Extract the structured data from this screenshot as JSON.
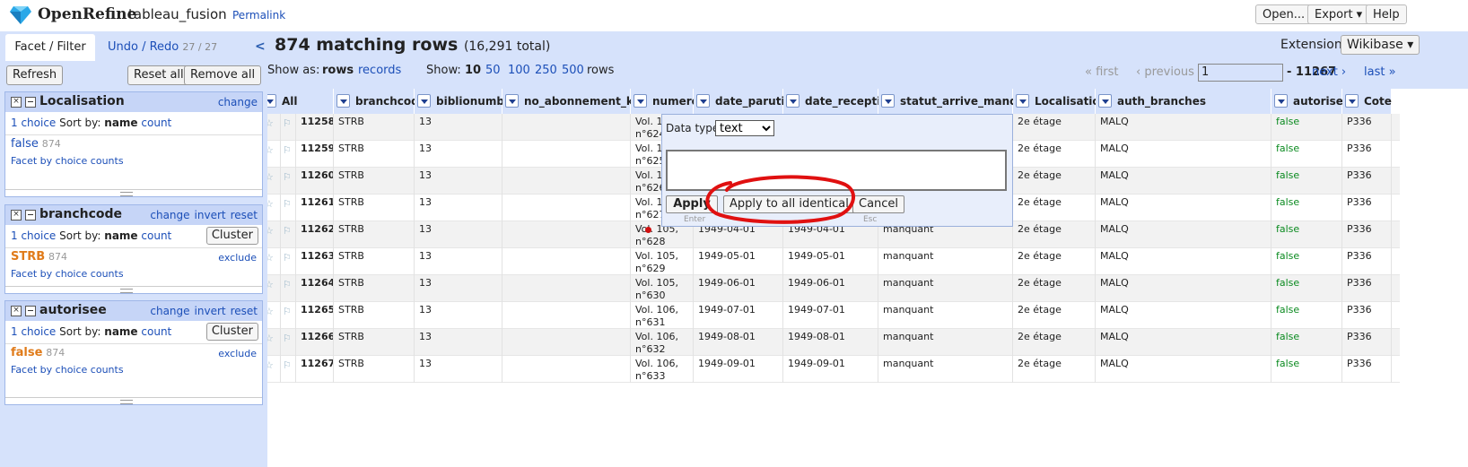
{
  "header": {
    "brand": "OpenRefine",
    "project_name": "tableau_fusion",
    "permalink": "Permalink",
    "buttons": {
      "open": "Open...",
      "export": "Export ▾",
      "help": "Help"
    }
  },
  "left_panel": {
    "tabs": {
      "facet_filter": "Facet / Filter",
      "undo_redo": "Undo / Redo",
      "undo_count": "27 / 27"
    },
    "refresh": "Refresh",
    "reset_all": "Reset all",
    "remove_all": "Remove all",
    "facets": [
      {
        "title": "Localisation",
        "links": [
          "change"
        ],
        "choices_text": "1 choice",
        "sort_by": "Sort by:",
        "sort_name": "name",
        "sort_count": "count",
        "cluster": "",
        "value": "false",
        "count": "874",
        "exclude": "",
        "footer": "Facet by choice counts",
        "value_color": "#1c4fb8"
      },
      {
        "title": "branchcode",
        "links": [
          "change",
          "invert",
          "reset"
        ],
        "choices_text": "1 choice",
        "sort_by": "Sort by:",
        "sort_name": "name",
        "sort_count": "count",
        "cluster": "Cluster",
        "value": "STRB",
        "count": "874",
        "exclude": "exclude",
        "footer": "Facet by choice counts",
        "value_color": "#e07b1a"
      },
      {
        "title": "autorisee",
        "links": [
          "change",
          "invert",
          "reset"
        ],
        "choices_text": "1 choice",
        "sort_by": "Sort by:",
        "sort_name": "name",
        "sort_count": "count",
        "cluster": "Cluster",
        "value": "false",
        "count": "874",
        "exclude": "exclude",
        "footer": "Facet by choice counts",
        "value_color": "#e07b1a"
      }
    ]
  },
  "toolbar": {
    "matching": "874 matching rows",
    "total": "(16,291 total)",
    "extensions": "Extensions",
    "wikibase": "Wikibase ▾",
    "show_as": "Show as:",
    "rows": "rows",
    "records": "records",
    "show": "Show:",
    "page_sizes": [
      "10",
      "50",
      "100",
      "250",
      "500"
    ],
    "rows_suffix": "rows",
    "first": "« first",
    "previous": "‹ previous",
    "page_input": "1",
    "page_total": "- 11267",
    "next": "next ›",
    "last": "last »"
  },
  "grid": {
    "all_label": "All",
    "columns": [
      "branchcode",
      "biblionumber",
      "no_abonnement_koha",
      "numero",
      "date_parution",
      "date_reception",
      "statut_arrive_manquant",
      "Localisation",
      "auth_branches",
      "autorisee",
      "Cote"
    ],
    "rows": [
      {
        "n": "11258.",
        "c": [
          "STRB",
          "13",
          "",
          "Vol. 1\nn°624",
          "",
          "",
          "",
          "2e étage",
          "MALQ",
          "false",
          "P336"
        ]
      },
      {
        "n": "11259.",
        "c": [
          "STRB",
          "13",
          "",
          "Vol. 1\nn°625",
          "",
          "",
          "",
          "2e étage",
          "MALQ",
          "false",
          "P336"
        ]
      },
      {
        "n": "11260.",
        "c": [
          "STRB",
          "13",
          "",
          "Vol. 1\nn°626",
          "",
          "",
          "",
          "2e étage",
          "MALQ",
          "false",
          "P336"
        ]
      },
      {
        "n": "11261.",
        "c": [
          "STRB",
          "13",
          "",
          "Vol. 1\nn°627",
          "",
          "",
          "",
          "2e étage",
          "MALQ",
          "false",
          "P336"
        ]
      },
      {
        "n": "11262.",
        "c": [
          "STRB",
          "13",
          "",
          "Vol. 105,\nn°628",
          "1949-04-01",
          "1949-04-01",
          "manquant",
          "2e étage",
          "MALQ",
          "false",
          "P336"
        ]
      },
      {
        "n": "11263.",
        "c": [
          "STRB",
          "13",
          "",
          "Vol. 105,\nn°629",
          "1949-05-01",
          "1949-05-01",
          "manquant",
          "2e étage",
          "MALQ",
          "false",
          "P336"
        ]
      },
      {
        "n": "11264.",
        "c": [
          "STRB",
          "13",
          "",
          "Vol. 105,\nn°630",
          "1949-06-01",
          "1949-06-01",
          "manquant",
          "2e étage",
          "MALQ",
          "false",
          "P336"
        ]
      },
      {
        "n": "11265.",
        "c": [
          "STRB",
          "13",
          "",
          "Vol. 106,\nn°631",
          "1949-07-01",
          "1949-07-01",
          "manquant",
          "2e étage",
          "MALQ",
          "false",
          "P336"
        ]
      },
      {
        "n": "11266.",
        "c": [
          "STRB",
          "13",
          "",
          "Vol. 106,\nn°632",
          "1949-08-01",
          "1949-08-01",
          "manquant",
          "2e étage",
          "MALQ",
          "false",
          "P336"
        ]
      },
      {
        "n": "11267.",
        "c": [
          "STRB",
          "13",
          "",
          "Vol. 106,\nn°633",
          "1949-09-01",
          "1949-09-01",
          "manquant",
          "2e étage",
          "MALQ",
          "false",
          "P336"
        ]
      }
    ]
  },
  "editor": {
    "data_type_label": "Data type:",
    "data_type_value": "text",
    "text_value": "",
    "apply": "Apply",
    "apply_all": "Apply to all identical cells",
    "cancel": "Cancel",
    "hint_enter": "Enter",
    "hint_esc": "Esc"
  },
  "colors": {
    "accent": "#1c4fb8",
    "panel_bg": "#d6e2fb",
    "annotation": "#e01010",
    "false_green": "#0a8a1f"
  }
}
